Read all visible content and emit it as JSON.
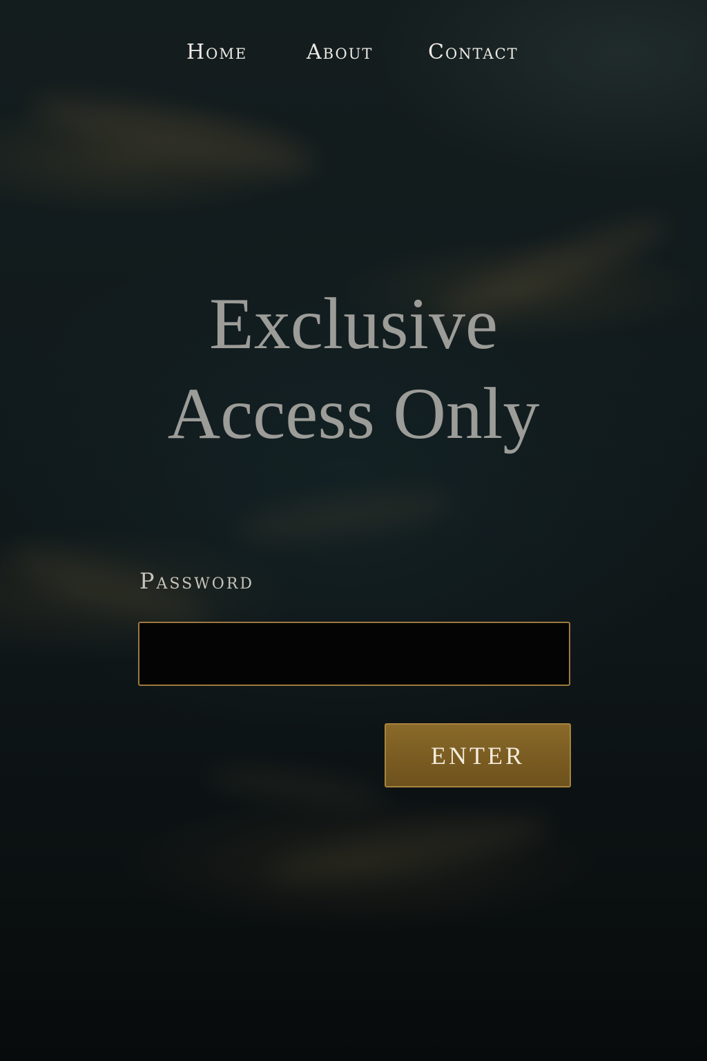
{
  "nav": {
    "items": [
      {
        "label": "Home"
      },
      {
        "label": "About"
      },
      {
        "label": "Contact"
      }
    ]
  },
  "hero": {
    "line1": "Exclusive",
    "line2": "Access Only"
  },
  "form": {
    "password_label": "Password",
    "password_value": "",
    "submit_label": "ENTER"
  },
  "colors": {
    "accent_gold": "#9d7a3e",
    "button_gold": "#7a5c22",
    "title_gray": "#9c9c98",
    "background": "#0d1416"
  }
}
